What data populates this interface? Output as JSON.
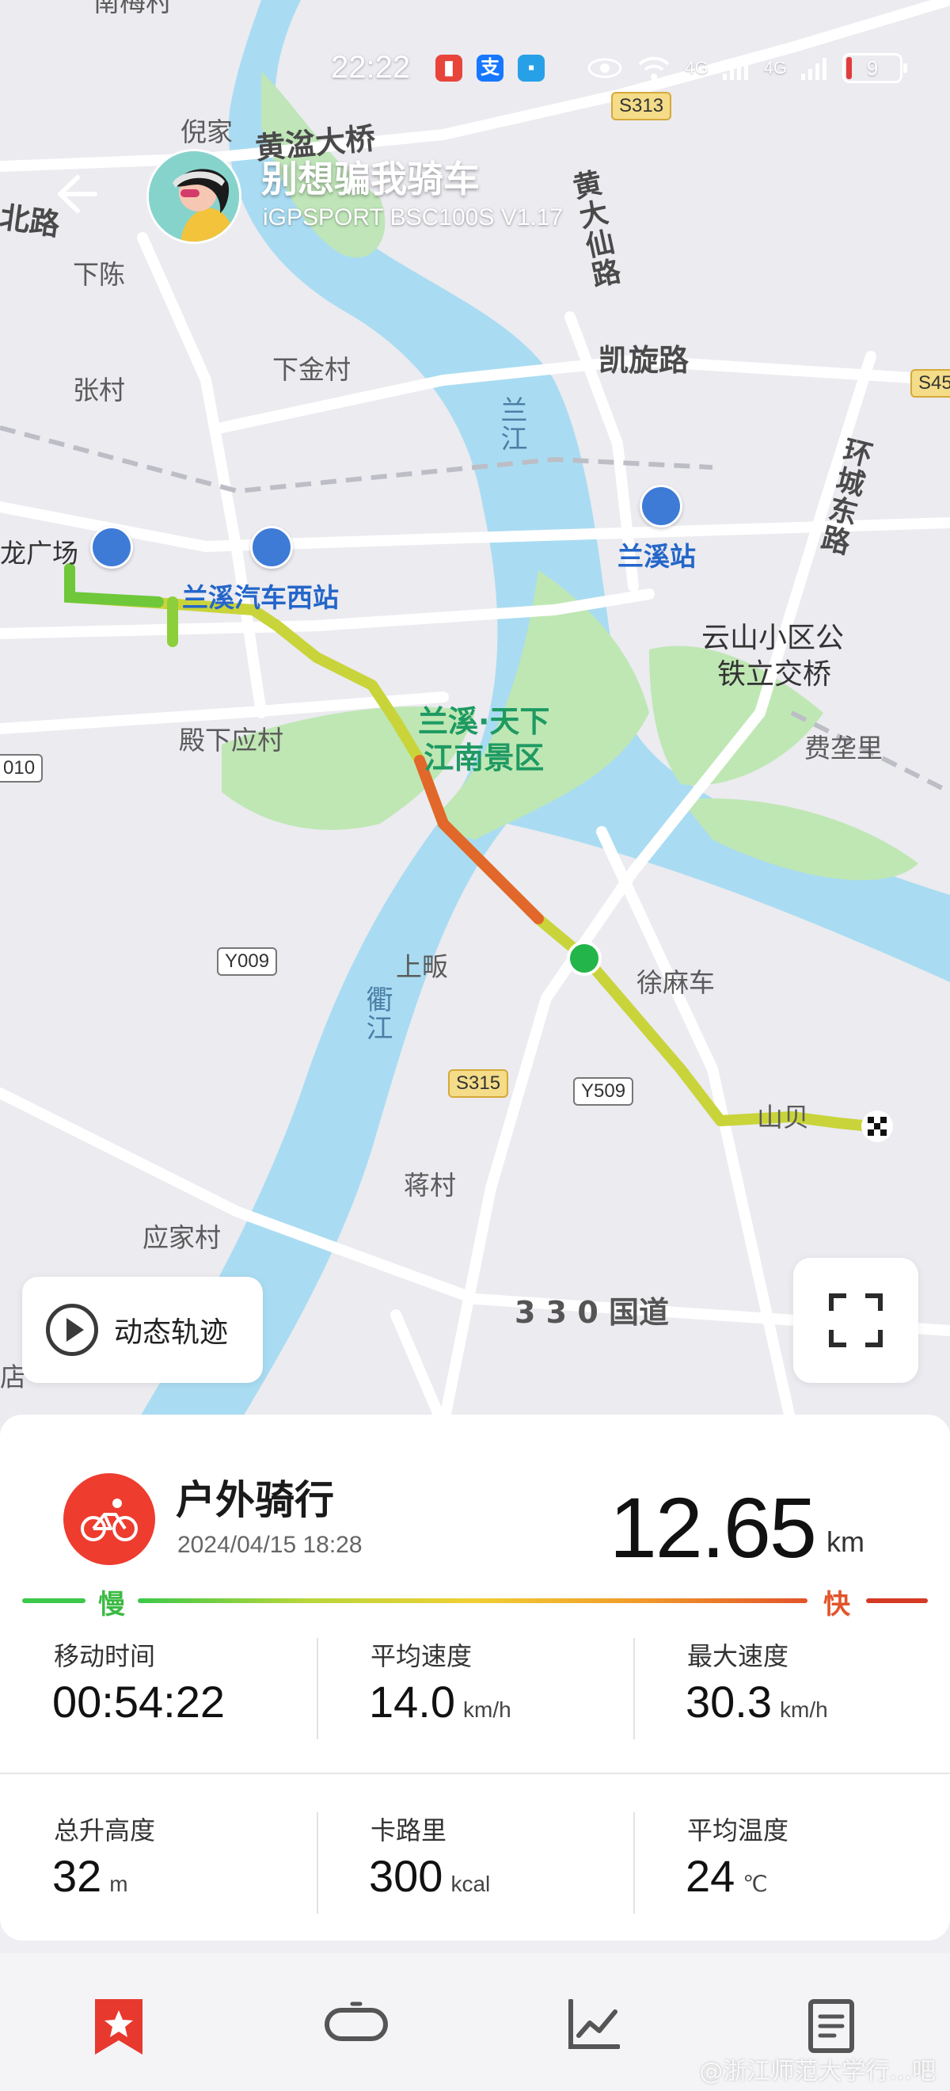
{
  "status_bar": {
    "time": "22:22",
    "network_1": "4G",
    "network_2": "4G",
    "battery_level": "9"
  },
  "header": {
    "user_name": "别想骗我骑车",
    "device": "iGPSPORT BSC100S  V1.17"
  },
  "map": {
    "labels": {
      "nijia": "倪家",
      "huangxi_bridge": "黄湓大桥",
      "beilu": "北路",
      "xiachen": "下陈",
      "zhangcun": "张村",
      "xiajincun": "下金村",
      "huangdaxian_road": "黄大仙路",
      "kaixuan_road": "凯旋路",
      "lanjiang": "兰江",
      "huancheng_east": "环城东路",
      "long_plaza": "龙广场",
      "bus_west_station": "兰溪汽车西站",
      "lanxi_station": "兰溪站",
      "yunshan": "云山小区公",
      "tieli_bridge": "铁立交桥",
      "dianxia": "殿下应村",
      "scenic": "兰溪·天下\n江南景区",
      "feiyuanli": "费垄里",
      "shangfan": "上畈",
      "quzhu": "衢江",
      "xumache": "徐麻车",
      "shanxia": "山贝",
      "jiangcun": "蒋村",
      "yingjia": "应家村",
      "national_330": "3 3 0 国道",
      "dian": "店",
      "nanmei": "南梅村"
    },
    "road_badges": {
      "s313": "S313",
      "s45": "S45",
      "y009": "Y009",
      "s315": "S315",
      "y509": "Y509",
      "r010": "010"
    }
  },
  "controls": {
    "track_label": "动态轨迹"
  },
  "summary": {
    "activity_type": "户外骑行",
    "date": "2024/04/15 18:28",
    "distance": "12.65",
    "distance_unit": "km",
    "legend_slow": "慢",
    "legend_fast": "快",
    "stats": [
      {
        "label": "移动时间",
        "value": "00:54:22",
        "unit": ""
      },
      {
        "label": "平均速度",
        "value": "14.0",
        "unit": "km/h"
      },
      {
        "label": "最大速度",
        "value": "30.3",
        "unit": "km/h"
      },
      {
        "label": "总升高度",
        "value": "32",
        "unit": "m"
      },
      {
        "label": "卡路里",
        "value": "300",
        "unit": "kcal"
      },
      {
        "label": "平均温度",
        "value": "24",
        "unit": "℃"
      }
    ]
  },
  "bottom_nav": {
    "items": [
      "star-bookmark-icon",
      "bike-lap-icon",
      "chart-line-icon",
      "document-icon"
    ],
    "active": 0,
    "accent": "#e8392f"
  },
  "watermark": "@浙江师范大学行...吧"
}
